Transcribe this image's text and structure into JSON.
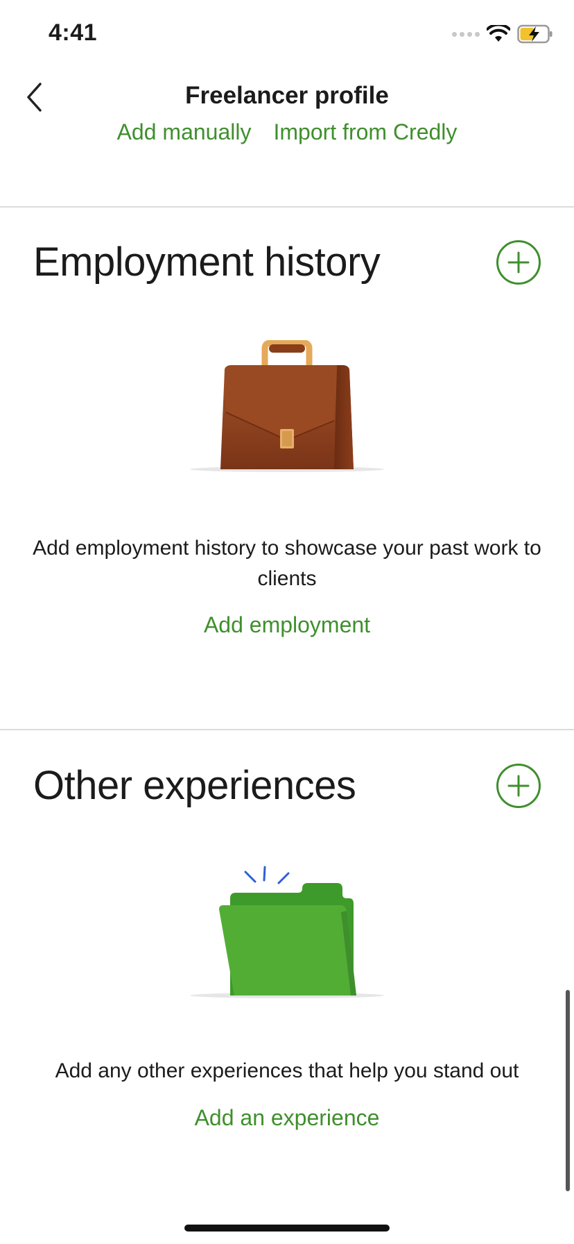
{
  "status_bar": {
    "time": "4:41"
  },
  "header": {
    "title": "Freelancer profile",
    "links": {
      "add_manually": "Add manually",
      "import_credly": "Import from Credly"
    }
  },
  "sections": {
    "employment": {
      "title": "Employment history",
      "description": "Add employment history to showcase your past work to clients",
      "cta": "Add employment"
    },
    "other": {
      "title": "Other experiences",
      "description": "Add any other experiences that help you stand out",
      "cta": "Add an experience"
    }
  },
  "colors": {
    "accent": "#3f8f2d",
    "text": "#1b1b1b",
    "divider": "#dcdcdc"
  },
  "icons": [
    "back-chevron-icon",
    "wifi-icon",
    "battery-charging-icon",
    "plus-icon",
    "briefcase-icon",
    "folder-icon"
  ]
}
